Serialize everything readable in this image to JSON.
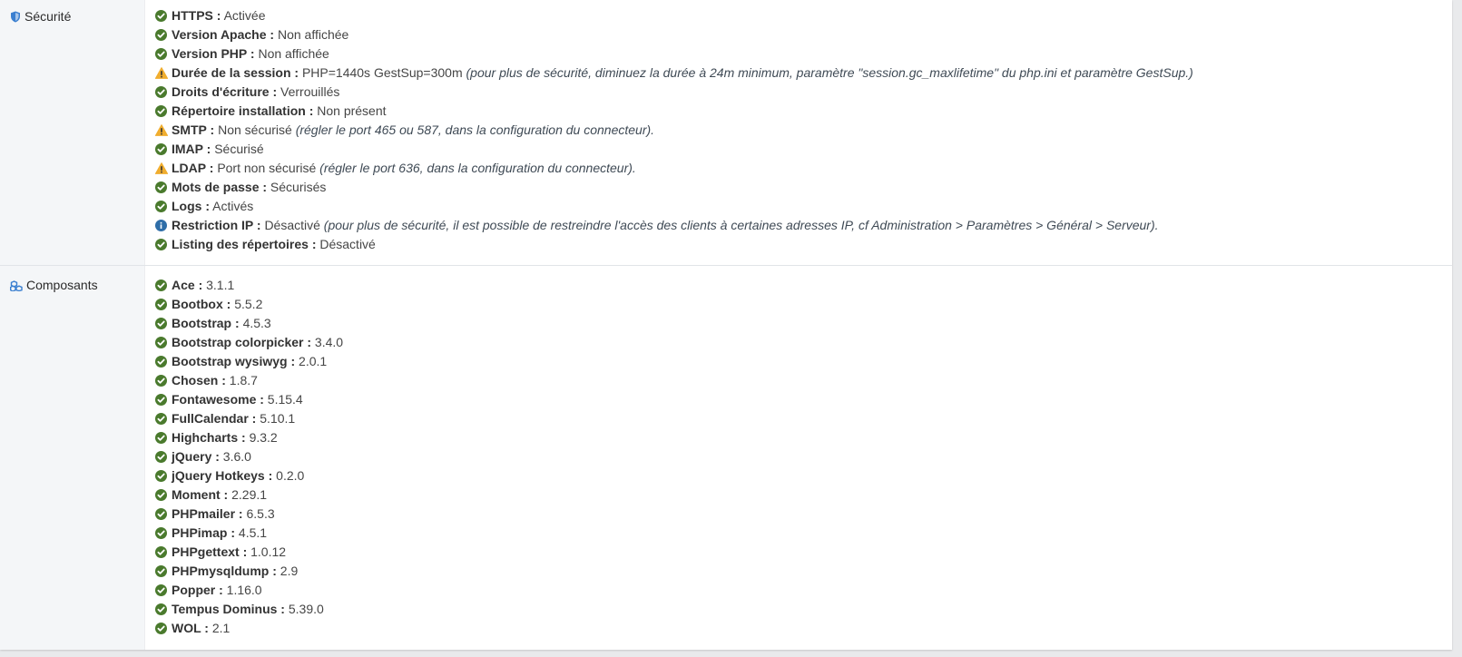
{
  "colors": {
    "ok": "#4a7a2d",
    "warn": "#f0ad2e",
    "info": "#2f6ea8",
    "shield": "#3a7fd0"
  },
  "security": {
    "title": "Sécurité",
    "icon": "shield-icon",
    "items": [
      {
        "status": "ok",
        "label": "HTTPS :",
        "value": "Activée",
        "note": ""
      },
      {
        "status": "ok",
        "label": "Version Apache :",
        "value": "Non affichée",
        "note": ""
      },
      {
        "status": "ok",
        "label": "Version PHP :",
        "value": "Non affichée",
        "note": ""
      },
      {
        "status": "warn",
        "label": "Durée de la session :",
        "value": "PHP=1440s GestSup=300m",
        "note": "(pour plus de sécurité, diminuez la durée à 24m minimum, paramètre \"session.gc_maxlifetime\" du php.ini et paramètre GestSup.)"
      },
      {
        "status": "ok",
        "label": "Droits d'écriture :",
        "value": "Verrouillés",
        "note": ""
      },
      {
        "status": "ok",
        "label": "Répertoire installation :",
        "value": "Non présent",
        "note": ""
      },
      {
        "status": "warn",
        "label": "SMTP :",
        "value": "Non sécurisé",
        "note": "(régler le port 465 ou 587, dans la configuration du connecteur)."
      },
      {
        "status": "ok",
        "label": "IMAP :",
        "value": "Sécurisé",
        "note": ""
      },
      {
        "status": "warn",
        "label": "LDAP :",
        "value": "Port non sécurisé",
        "note": "(régler le port 636, dans la configuration du connecteur)."
      },
      {
        "status": "ok",
        "label": "Mots de passe :",
        "value": "Sécurisés",
        "note": ""
      },
      {
        "status": "ok",
        "label": "Logs :",
        "value": "Activés",
        "note": ""
      },
      {
        "status": "info",
        "label": "Restriction IP :",
        "value": "Désactivé",
        "note": "(pour plus de sécurité, il est possible de restreindre l'accès des clients à certaines adresses IP, cf Administration > Paramètres > Général > Serveur)."
      },
      {
        "status": "ok",
        "label": "Listing des répertoires :",
        "value": "Désactivé",
        "note": ""
      }
    ]
  },
  "components": {
    "title": "Composants",
    "icon": "cubes-icon",
    "items": [
      {
        "status": "ok",
        "label": "Ace :",
        "value": "3.1.1"
      },
      {
        "status": "ok",
        "label": "Bootbox :",
        "value": "5.5.2"
      },
      {
        "status": "ok",
        "label": "Bootstrap :",
        "value": "4.5.3"
      },
      {
        "status": "ok",
        "label": "Bootstrap colorpicker :",
        "value": "3.4.0"
      },
      {
        "status": "ok",
        "label": "Bootstrap wysiwyg :",
        "value": "2.0.1"
      },
      {
        "status": "ok",
        "label": "Chosen :",
        "value": "1.8.7"
      },
      {
        "status": "ok",
        "label": "Fontawesome :",
        "value": "5.15.4"
      },
      {
        "status": "ok",
        "label": "FullCalendar :",
        "value": "5.10.1"
      },
      {
        "status": "ok",
        "label": "Highcharts :",
        "value": "9.3.2"
      },
      {
        "status": "ok",
        "label": "jQuery :",
        "value": "3.6.0"
      },
      {
        "status": "ok",
        "label": "jQuery Hotkeys :",
        "value": "0.2.0"
      },
      {
        "status": "ok",
        "label": "Moment :",
        "value": "2.29.1"
      },
      {
        "status": "ok",
        "label": "PHPmailer :",
        "value": "6.5.3"
      },
      {
        "status": "ok",
        "label": "PHPimap :",
        "value": "4.5.1"
      },
      {
        "status": "ok",
        "label": "PHPgettext :",
        "value": "1.0.12"
      },
      {
        "status": "ok",
        "label": "PHPmysqldump :",
        "value": "2.9"
      },
      {
        "status": "ok",
        "label": "Popper :",
        "value": "1.16.0"
      },
      {
        "status": "ok",
        "label": "Tempus Dominus :",
        "value": "5.39.0"
      },
      {
        "status": "ok",
        "label": "WOL :",
        "value": "2.1"
      }
    ]
  }
}
